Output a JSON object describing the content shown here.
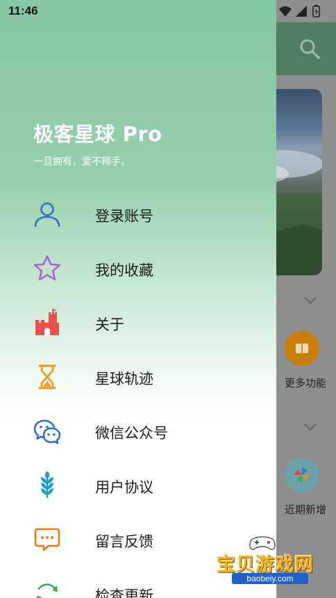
{
  "status_bar": {
    "time": "11:46"
  },
  "drawer": {
    "title": "极客星球 Pro",
    "subtitle": "一旦拥有，爱不释手。",
    "items": [
      {
        "label": "登录账号",
        "icon": "user-icon",
        "color": "#2f6fc7"
      },
      {
        "label": "我的收藏",
        "icon": "star-icon",
        "color": "#a55fd2"
      },
      {
        "label": "关于",
        "icon": "castle-icon",
        "color": "#e7524a"
      },
      {
        "label": "星球轨迹",
        "icon": "hourglass-icon",
        "color": "#f39a1a"
      },
      {
        "label": "微信公众号",
        "icon": "wechat-icon",
        "color": "#2f6fc7"
      },
      {
        "label": "用户协议",
        "icon": "wheat-icon",
        "color": "#1e9ccd"
      },
      {
        "label": "留言反馈",
        "icon": "message-icon",
        "color": "#ea7a1c"
      },
      {
        "label": "检查更新",
        "icon": "refresh-icon",
        "color": "#3fae5a"
      }
    ]
  },
  "background_app": {
    "functions": [
      {
        "label": "更多功能",
        "icon": "book-icon",
        "color": "#e6950f"
      },
      {
        "label": "近期新增",
        "icon": "pinwheel-icon",
        "color": "#7fc7cf"
      }
    ]
  },
  "watermark": {
    "text": "宝贝游戏网",
    "url": "baobeiy.com"
  }
}
